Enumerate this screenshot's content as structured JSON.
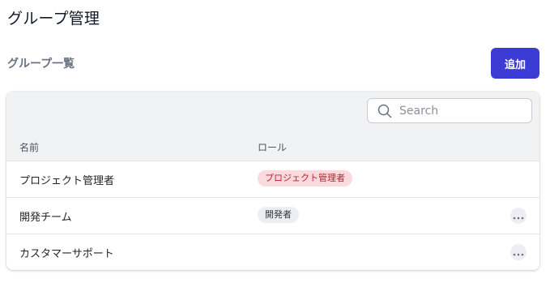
{
  "page": {
    "title": "グループ管理",
    "section_title": "グループ一覧"
  },
  "toolbar": {
    "add_label": "追加"
  },
  "search": {
    "placeholder": "Search",
    "value": ""
  },
  "table": {
    "columns": [
      "名前",
      "ロール"
    ],
    "rows": [
      {
        "name": "プロジェクト管理者",
        "role": "プロジェクト管理者",
        "role_color": "red",
        "has_menu": false
      },
      {
        "name": "開発チーム",
        "role": "開発者",
        "role_color": "gray",
        "has_menu": true
      },
      {
        "name": "カスタマーサポート",
        "role": "",
        "role_color": "",
        "has_menu": true
      }
    ]
  },
  "icons": {
    "search": "search-icon",
    "more": "more-horizontal-icon"
  },
  "colors": {
    "accent": "#3d3bd6",
    "badge_red_bg": "#fbdadd",
    "badge_red_text": "#b42333",
    "badge_gray_bg": "#eceef1"
  }
}
